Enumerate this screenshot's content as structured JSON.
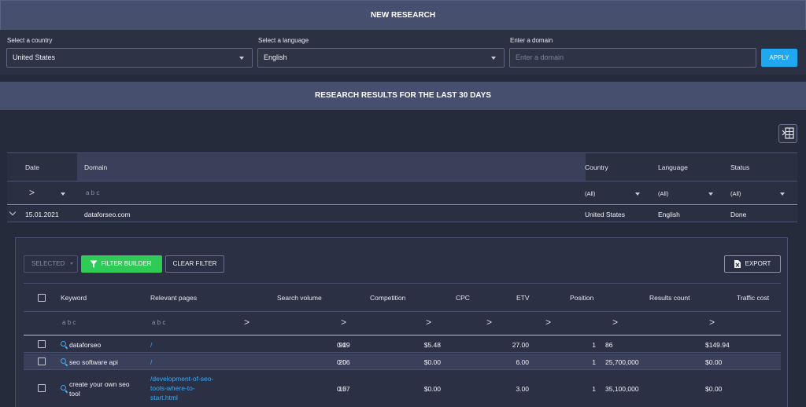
{
  "new_research": {
    "title": "NEW RESEARCH",
    "country": {
      "label": "Select a country",
      "value": "United States"
    },
    "language": {
      "label": "Select a language",
      "value": "English"
    },
    "domain": {
      "label": "Enter a domain",
      "placeholder": "Enter a domain"
    },
    "apply_label": "APPLY"
  },
  "results": {
    "title": "RESEARCH RESULTS FOR THE LAST 30 DAYS",
    "columns": [
      "Date",
      "Domain",
      "Country",
      "Language",
      "Status"
    ],
    "filter": {
      "date_op": ">",
      "domain_op": "a b c",
      "country": "(All)",
      "language": "(All)",
      "status": "(All)"
    },
    "rows": [
      {
        "date": "15.01.2021",
        "domain": "dataforseo.com",
        "country": "United States",
        "language": "English",
        "status": "Done"
      }
    ]
  },
  "detail": {
    "selected_label": "SELECTED",
    "filter_builder_label": "FILTER BUILDER",
    "clear_filter_label": "CLEAR FILTER",
    "export_label": "EXPORT",
    "columns": [
      "Keyword",
      "Relevant pages",
      "Search volume",
      "Competition",
      "CPC",
      "ETV",
      "Position",
      "Results count",
      "Traffic cost"
    ],
    "filter_ops": {
      "keyword": "a b c",
      "pages": "a b c",
      "gt": ">"
    },
    "rows": [
      {
        "keyword": "dataforseo",
        "page": "/",
        "search_volume": "90",
        "competition": "0.19",
        "cpc": "$5.48",
        "etv": "27.00",
        "position": "1",
        "results_count": "86",
        "traffic_cost": "$149.94"
      },
      {
        "keyword": "seo software api",
        "page": "/",
        "search_volume": "20",
        "competition": "0.06",
        "cpc": "$0.00",
        "etv": "6.00",
        "position": "1",
        "results_count": "25,700,000",
        "traffic_cost": "$0.00"
      },
      {
        "keyword_line1": "create your own seo",
        "keyword_line2": "tool",
        "page_line1": "/development-of-seo-",
        "page_line2": "tools-where-to-",
        "page_line3": "start.html",
        "search_volume": "10",
        "competition": "0.57",
        "cpc": "$0.00",
        "etv": "3.00",
        "position": "1",
        "results_count": "35,100,000",
        "traffic_cost": "$0.00"
      }
    ]
  },
  "colors": {
    "accent_blue": "#1fa8f0",
    "filter_green": "#2ecc57",
    "banner": "#474f6e",
    "background": "#262b3b"
  }
}
